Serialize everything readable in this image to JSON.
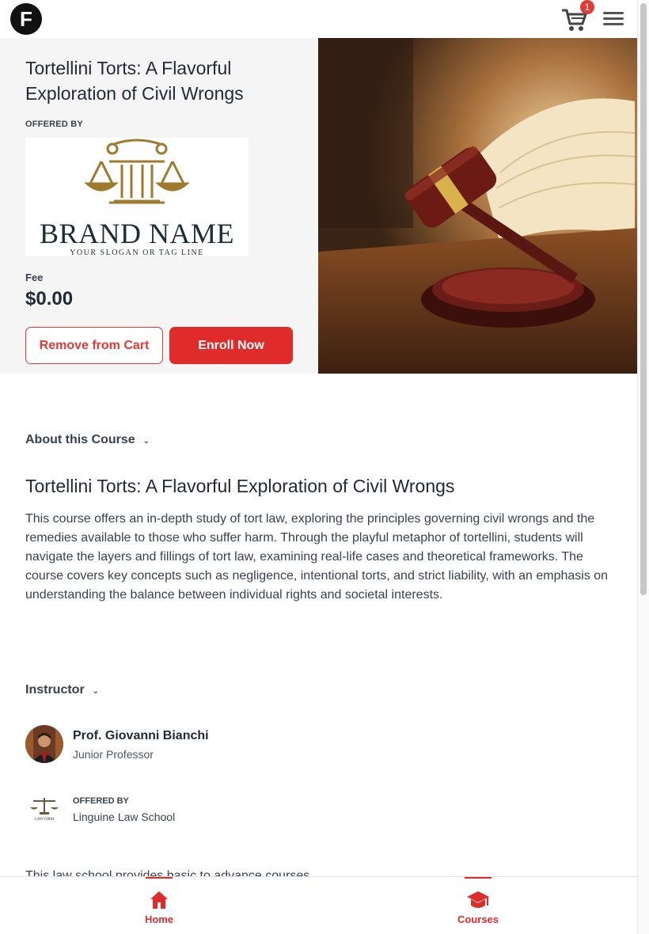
{
  "header": {
    "logo_letter": "F",
    "cart_count": "1"
  },
  "hero": {
    "title": "Tortellini Torts: A Flavorful Exploration of Civil Wrongs",
    "offered_by_label": "OFFERED BY",
    "brand_name": "BRAND NAME",
    "brand_slogan": "YOUR SLOGAN OR TAG LINE",
    "fee_label": "Fee",
    "fee_value": "$0.00",
    "remove_button": "Remove from Cart",
    "enroll_button": "Enroll Now",
    "image_icon": "gavel-and-books-image"
  },
  "about": {
    "toggle_label": "About this Course",
    "course_title": "Tortellini Torts: A Flavorful Exploration of Civil Wrongs",
    "description": "This course offers an in-depth study of tort law, exploring the principles governing civil wrongs and the remedies available to those who suffer harm. Through the playful metaphor of tortellini, students will navigate the layers and fillings of tort law, examining real-life cases and theoretical frameworks. The course covers key concepts such as negligence, intentional torts, and strict liability, with an emphasis on understanding the balance between individual rights and societal interests."
  },
  "instructor": {
    "toggle_label": "Instructor",
    "name": "Prof. Giovanni Bianchi",
    "role": "Junior Professor",
    "offered_by_label": "OFFERED BY",
    "school_name": "Linguine Law School",
    "school_logo_text": "LAW FIRM",
    "school_description": "This law school provides basic to advance courses."
  },
  "bottom_nav": {
    "items": [
      {
        "label": "Home",
        "icon": "home-icon"
      },
      {
        "label": "Courses",
        "icon": "graduation-cap-icon"
      }
    ]
  },
  "colors": {
    "accent": "#e02b2b",
    "brand_dark": "#1b2e35",
    "brand_gold": "#a07a2c"
  }
}
